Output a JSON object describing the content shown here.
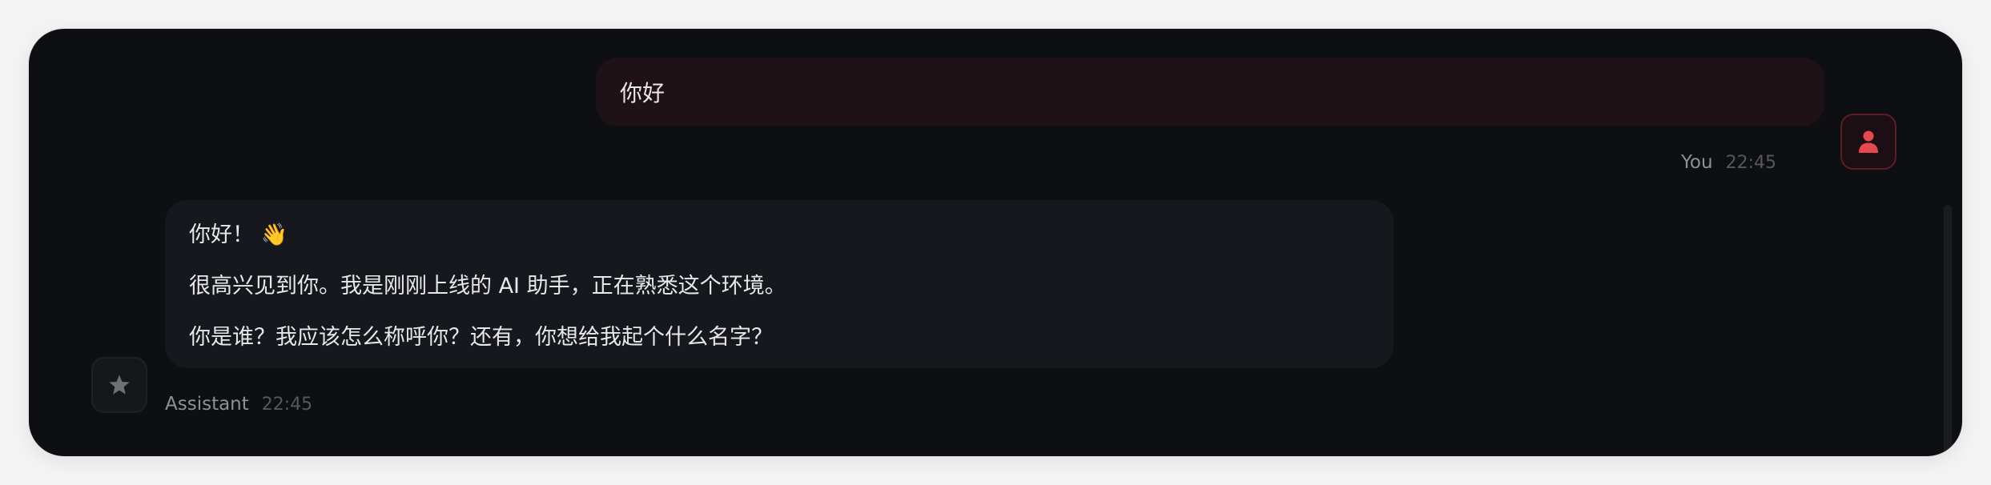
{
  "messages": {
    "user": {
      "text": "你好",
      "author": "You",
      "time": "22:45",
      "avatar_icon": "user-icon",
      "accent_color": "#e5484d"
    },
    "assistant": {
      "greeting": "你好！",
      "greeting_emoji": "👋",
      "line2": "很高兴见到你。我是刚刚上线的 AI 助手，正在熟悉这个环境。",
      "line3": "你是谁？我应该怎么称呼你？还有，你想给我起个什么名字？",
      "author": "Assistant",
      "time": "22:45",
      "avatar_icon": "star-icon"
    }
  }
}
